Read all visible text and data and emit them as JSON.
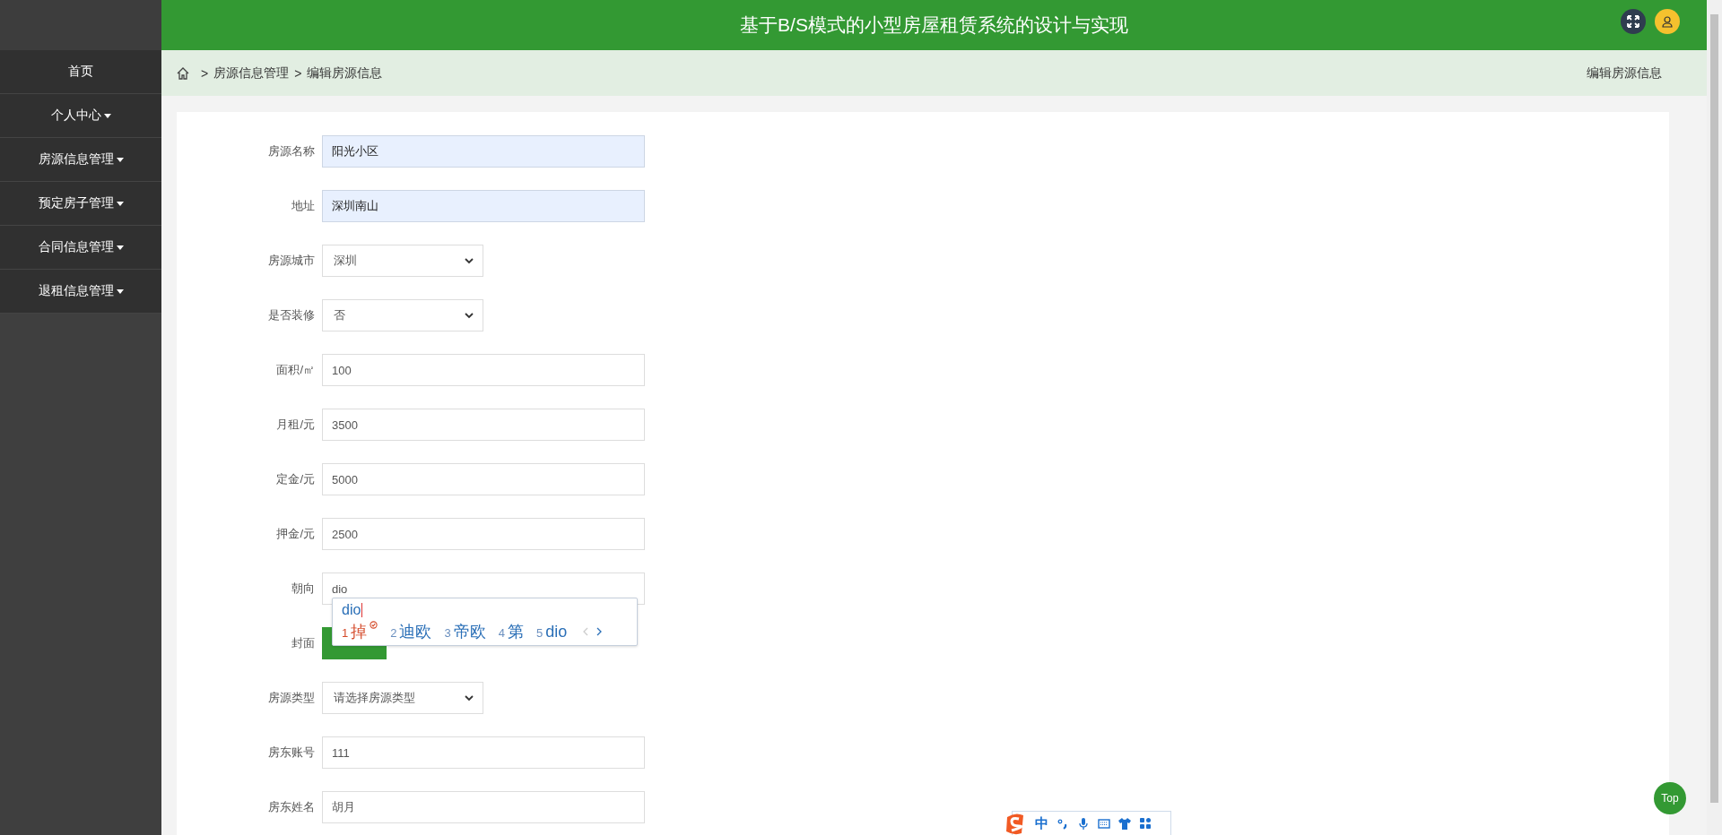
{
  "header": {
    "title": "基于B/S模式的小型房屋租赁系统的设计与实现"
  },
  "sidebar": {
    "items": [
      {
        "label": "首页",
        "has_submenu": false
      },
      {
        "label": "个人中心",
        "has_submenu": true
      },
      {
        "label": "房源信息管理",
        "has_submenu": true
      },
      {
        "label": "预定房子管理",
        "has_submenu": true
      },
      {
        "label": "合同信息管理",
        "has_submenu": true
      },
      {
        "label": "退租信息管理",
        "has_submenu": true
      }
    ]
  },
  "breadcrumb": {
    "items": [
      {
        "separator": ">",
        "label": "房源信息管理"
      },
      {
        "separator": ">",
        "label": "编辑房源信息"
      }
    ],
    "page_title": "编辑房源信息"
  },
  "form": {
    "fields": [
      {
        "kind": "text",
        "label": "房源名称",
        "value": "阳光小区",
        "autofilled": true
      },
      {
        "kind": "text",
        "label": "地址",
        "value": "深圳南山",
        "autofilled": true
      },
      {
        "kind": "select",
        "label": "房源城市",
        "value": "深圳"
      },
      {
        "kind": "select",
        "label": "是否装修",
        "value": "否"
      },
      {
        "kind": "text",
        "label": "面积/㎡",
        "value": "100",
        "autofilled": false
      },
      {
        "kind": "text",
        "label": "月租/元",
        "value": "3500",
        "autofilled": false
      },
      {
        "kind": "text",
        "label": "定金/元",
        "value": "5000",
        "autofilled": false
      },
      {
        "kind": "text",
        "label": "押金/元",
        "value": "2500",
        "autofilled": false
      },
      {
        "kind": "text",
        "label": "朝向",
        "value": "dio",
        "autofilled": false
      },
      {
        "kind": "upload",
        "label": "封面"
      },
      {
        "kind": "select",
        "label": "房源类型",
        "value": "请选择房源类型"
      },
      {
        "kind": "text",
        "label": "房东账号",
        "value": "111",
        "autofilled": false
      },
      {
        "kind": "text",
        "label": "房东姓名",
        "value": "胡月",
        "autofilled": false
      }
    ]
  },
  "ime_popup": {
    "composition": "dio",
    "candidates": [
      {
        "number": "1",
        "text": "掉",
        "selected": true
      },
      {
        "number": "2",
        "text": "迪欧",
        "selected": false
      },
      {
        "number": "3",
        "text": "帝欧",
        "selected": false
      },
      {
        "number": "4",
        "text": "第",
        "selected": false
      },
      {
        "number": "5",
        "text": "dio",
        "selected": false
      }
    ]
  },
  "ime_toolbar": {
    "mode": "中"
  },
  "top_button": {
    "label": "Top"
  }
}
